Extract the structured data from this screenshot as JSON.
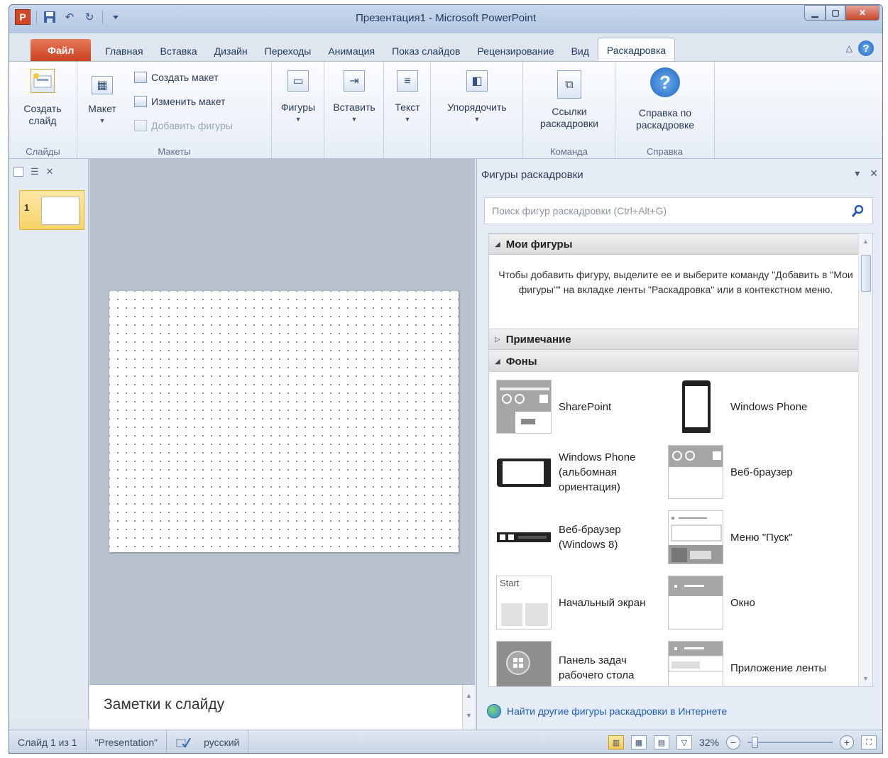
{
  "titlebar": {
    "app_letter": "P",
    "title": "Презентация1  -  Microsoft PowerPoint",
    "undo": "↶",
    "redo": "↻"
  },
  "tabs": [
    {
      "label": "Файл"
    },
    {
      "label": "Главная"
    },
    {
      "label": "Вставка"
    },
    {
      "label": "Дизайн"
    },
    {
      "label": "Переходы"
    },
    {
      "label": "Анимация"
    },
    {
      "label": "Показ слайдов"
    },
    {
      "label": "Рецензирование"
    },
    {
      "label": "Вид"
    },
    {
      "label": "Раскадровка"
    }
  ],
  "ribbon": {
    "new_slide": "Создать слайд",
    "layout": "Макет",
    "create_layout": "Создать макет",
    "edit_layout": "Изменить макет",
    "add_shapes": "Добавить фигуры",
    "shapes": "Фигуры",
    "insert": "Вставить",
    "text": "Текст",
    "arrange": "Упорядочить",
    "links": "Ссылки раскадровки",
    "help": "Справка по раскадровке",
    "groups": {
      "slides": "Слайды",
      "layouts": "Макеты",
      "team": "Команда",
      "help": "Справка"
    }
  },
  "slides_pane": {
    "slide_number": "1"
  },
  "notes": {
    "placeholder": "Заметки к слайду"
  },
  "taskpane": {
    "title": "Фигуры раскадровки",
    "search_placeholder": "Поиск фигур раскадровки (Ctrl+Alt+G)",
    "my_shapes": "Мои фигуры",
    "my_shapes_info": "Чтобы добавить фигуру, выделите ее и выберите команду \"Добавить в \"Мои фигуры\"\" на вкладке ленты \"Раскадровка\" или в контекстном меню.",
    "note_section": "Примечание",
    "backgrounds_section": "Фоны",
    "items": [
      {
        "label": "SharePoint"
      },
      {
        "label": "Windows Phone"
      },
      {
        "label": "Windows Phone (альбомная ориентация)"
      },
      {
        "label": "Веб-браузер"
      },
      {
        "label": "Веб-браузер (Windows 8)"
      },
      {
        "label": "Меню \"Пуск\""
      },
      {
        "label": "Начальный экран",
        "thumb_text": "Start"
      },
      {
        "label": "Окно"
      },
      {
        "label": "Панель задач рабочего стола"
      },
      {
        "label": "Приложение ленты"
      }
    ],
    "online_link": "Найти другие фигуры раскадровки в Интернете"
  },
  "statusbar": {
    "slide_info": "Слайд 1 из 1",
    "theme": "\"Presentation\"",
    "language": "русский",
    "zoom": "32%",
    "zoom_level": 0.32
  },
  "colors": {
    "file_tab": "#c7401d",
    "accent": "#1f64bf",
    "ribbon_bg": "#e6edf6"
  }
}
